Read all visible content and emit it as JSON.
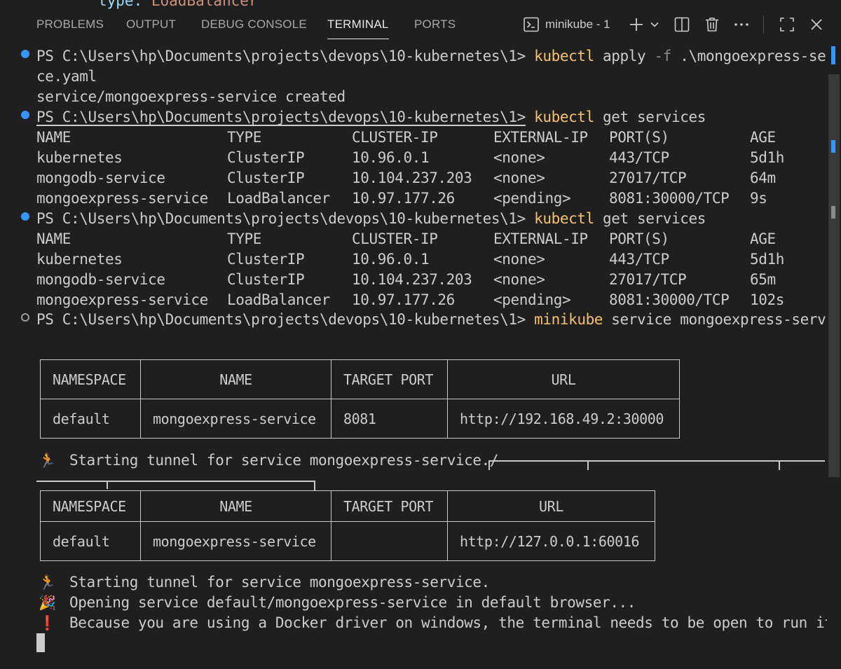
{
  "peek": {
    "key": "type:",
    "value": "LoadBalancer"
  },
  "tabs": [
    {
      "label": "PROBLEMS"
    },
    {
      "label": "OUTPUT"
    },
    {
      "label": "DEBUG CONSOLE"
    },
    {
      "label": "TERMINAL"
    },
    {
      "label": "PORTS"
    }
  ],
  "terminal_instance": {
    "label": "minikube - 1",
    "icon": "terminal-icon"
  },
  "toolbar_icons": [
    "plus-icon",
    "chevron-down-icon",
    "split-icon",
    "trash-icon",
    "ellipsis-icon",
    "maximize-icon",
    "close-icon"
  ],
  "prompt": "PS C:\\Users\\hp\\Documents\\projects\\devops\\10-kubernetes\\1>",
  "cmd1": {
    "exe": "kubectl",
    "args_a": " apply ",
    "flag": "-f",
    "args_b": " .\\mongoexpress-servi",
    "wrap": "ce.yaml"
  },
  "cmd1_output": "service/mongoexpress-service created",
  "cmd2": {
    "exe": "kubectl",
    "args": " get services"
  },
  "svc_headers": [
    "NAME",
    "TYPE",
    "CLUSTER-IP",
    "EXTERNAL-IP",
    "PORT(S)",
    "AGE"
  ],
  "svc_table_1": [
    [
      "kubernetes",
      "ClusterIP",
      "10.96.0.1",
      "<none>",
      "443/TCP",
      "5d1h"
    ],
    [
      "mongodb-service",
      "ClusterIP",
      "10.104.237.203",
      "<none>",
      "27017/TCP",
      "64m"
    ],
    [
      "mongoexpress-service",
      "LoadBalancer",
      "10.97.177.26",
      "<pending>",
      "8081:30000/TCP",
      "9s"
    ]
  ],
  "cmd3": {
    "exe": "kubectl",
    "args": " get services"
  },
  "svc_table_2": [
    [
      "kubernetes",
      "ClusterIP",
      "10.96.0.1",
      "<none>",
      "443/TCP",
      "5d1h"
    ],
    [
      "mongodb-service",
      "ClusterIP",
      "10.104.237.203",
      "<none>",
      "27017/TCP",
      "65m"
    ],
    [
      "mongoexpress-service",
      "LoadBalancer",
      "10.97.177.26",
      "<pending>",
      "8081:30000/TCP",
      "102s"
    ]
  ],
  "cmd4": {
    "exe": "minikube",
    "args": " service mongoexpress-service"
  },
  "mk_headers": [
    "NAMESPACE",
    "NAME",
    "TARGET PORT",
    "URL"
  ],
  "mk_table_1": [
    "default",
    "mongoexpress-service",
    "8081",
    "http://192.168.49.2:30000"
  ],
  "tunnel_msg_1": "Starting tunnel for service mongoexpress-service./",
  "mk_table_2": [
    "default",
    "mongoexpress-service",
    "",
    "http://127.0.0.1:60016"
  ],
  "tunnel_msg_2": "Starting tunnel for service mongoexpress-service.",
  "open_msg": "Opening service default/mongoexpress-service in default browser...",
  "warn_msg": "Because you are using a Docker driver on windows, the terminal needs to be open to run it.",
  "emoji_runner": "🏃",
  "emoji_party": "🎉",
  "emoji_bang": "❗"
}
